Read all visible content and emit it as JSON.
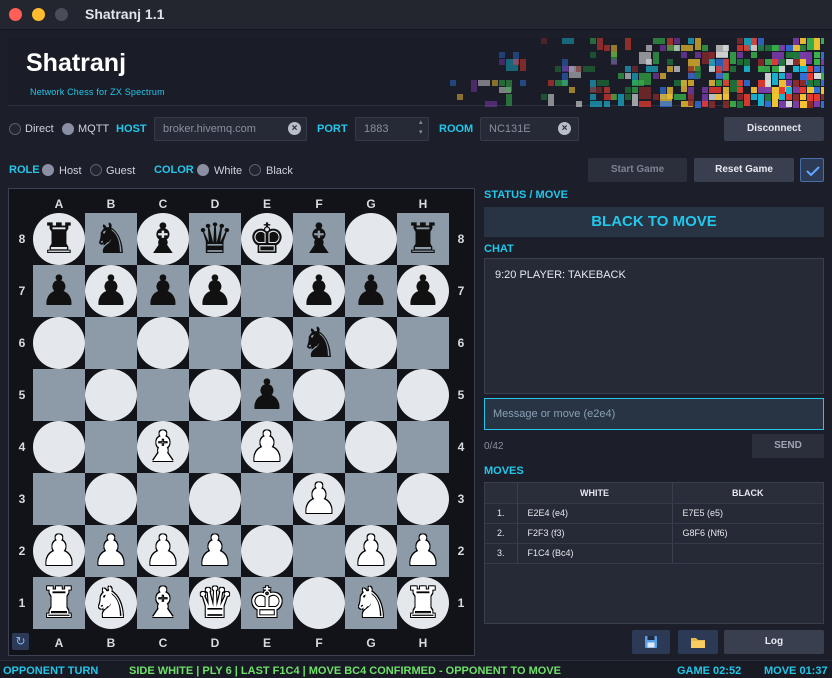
{
  "window": {
    "title": "Shatranj 1.1"
  },
  "header": {
    "title": "Shatranj",
    "subtitle": "Network Chess for ZX Spectrum"
  },
  "connection": {
    "mode_options": [
      {
        "label": "Direct",
        "selected": false
      },
      {
        "label": "MQTT",
        "selected": true
      }
    ],
    "host_label": "HOST",
    "host_value": "broker.hivemq.com",
    "port_label": "PORT",
    "port_value": "1883",
    "room_label": "ROOM",
    "room_value": "NC131E",
    "disconnect_label": "Disconnect"
  },
  "role": {
    "label": "ROLE",
    "options": [
      {
        "label": "Host",
        "selected": true
      },
      {
        "label": "Guest",
        "selected": false
      }
    ]
  },
  "color": {
    "label": "COLOR",
    "options": [
      {
        "label": "White",
        "selected": true
      },
      {
        "label": "Black",
        "selected": false
      }
    ]
  },
  "game_buttons": {
    "start": "Start Game",
    "reset": "Reset Game"
  },
  "board": {
    "files": [
      "A",
      "B",
      "C",
      "D",
      "E",
      "F",
      "G",
      "H"
    ],
    "ranks": [
      "8",
      "7",
      "6",
      "5",
      "4",
      "3",
      "2",
      "1"
    ],
    "position": [
      [
        "br",
        "bn",
        "bb",
        "bq",
        "bk",
        "bb",
        "",
        "br"
      ],
      [
        "bp",
        "bp",
        "bp",
        "bp",
        "",
        "bp",
        "bp",
        "bp"
      ],
      [
        "",
        "",
        "",
        "",
        "",
        "bn",
        "",
        ""
      ],
      [
        "",
        "",
        "",
        "",
        "bp",
        "",
        "",
        ""
      ],
      [
        "",
        "",
        "wb",
        "",
        "wp",
        "",
        "",
        ""
      ],
      [
        "",
        "",
        "",
        "",
        "",
        "wp",
        "",
        ""
      ],
      [
        "wp",
        "wp",
        "wp",
        "wp",
        "",
        "",
        "wp",
        "wp"
      ],
      [
        "wr",
        "wn",
        "wb",
        "wq",
        "wk",
        "",
        "wn",
        "wr"
      ]
    ]
  },
  "status": {
    "label": "STATUS / MOVE",
    "text": "BLACK TO MOVE"
  },
  "chat": {
    "label": "CHAT",
    "messages": [
      "9:20 PLAYER: TAKEBACK"
    ],
    "input_placeholder": "Message or move (e2e4)",
    "char_count": "0/42",
    "send_label": "SEND"
  },
  "moves": {
    "label": "MOVES",
    "headers": [
      "WHITE",
      "BLACK"
    ],
    "rows": [
      {
        "num": "1.",
        "white": "E2E4 (e4)",
        "black": "E7E5 (e5)"
      },
      {
        "num": "2.",
        "white": "F2F3 (f3)",
        "black": "G8F6 (Nf6)"
      },
      {
        "num": "3.",
        "white": "F1C4 (Bc4)",
        "black": ""
      }
    ]
  },
  "bottom_buttons": {
    "log": "Log"
  },
  "statusbar": {
    "left": "OPPONENT TURN",
    "center": "SIDE WHITE | PLY 6 | LAST F1C4 | MOVE BC4 CONFIRMED - OPPONENT TO MOVE",
    "game_time": "GAME 02:52",
    "move_time": "MOVE 01:37"
  },
  "colors": {
    "accent": "#22c7ea",
    "status_green": "#6fe06a",
    "light_square": "#e4e8ec",
    "dark_square": "#8d9ba8"
  }
}
